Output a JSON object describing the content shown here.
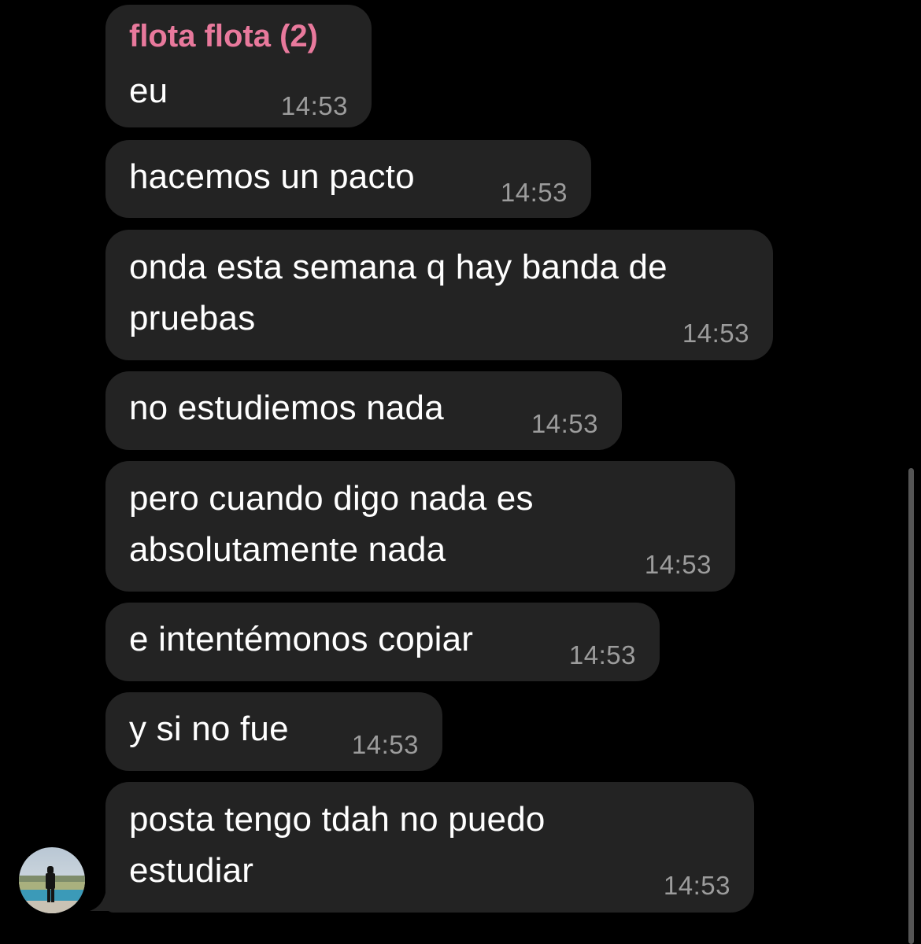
{
  "chat": {
    "sender_name": "flota flota (2)",
    "messages": [
      {
        "text": "eu",
        "time": "14:53"
      },
      {
        "text": "hacemos un pacto",
        "time": "14:53"
      },
      {
        "line1": "onda esta semana q hay banda de",
        "line2": "pruebas",
        "time": "14:53"
      },
      {
        "text": "no estudiemos nada",
        "time": "14:53"
      },
      {
        "line1": "pero cuando digo nada es",
        "line2": "absolutamente nada",
        "time": "14:53"
      },
      {
        "text": "e intentémonos copiar",
        "time": "14:53"
      },
      {
        "text": "y si no fue",
        "time": "14:53"
      },
      {
        "line1": "posta tengo tdah no puedo",
        "line2": "estudiar",
        "time": "14:53"
      }
    ]
  },
  "colors": {
    "background": "#000000",
    "bubble": "#232323",
    "sender_name": "#e8799c",
    "timestamp": "#9c9c9c",
    "text": "#ffffff"
  },
  "icons": {
    "avatar": "avatar"
  }
}
